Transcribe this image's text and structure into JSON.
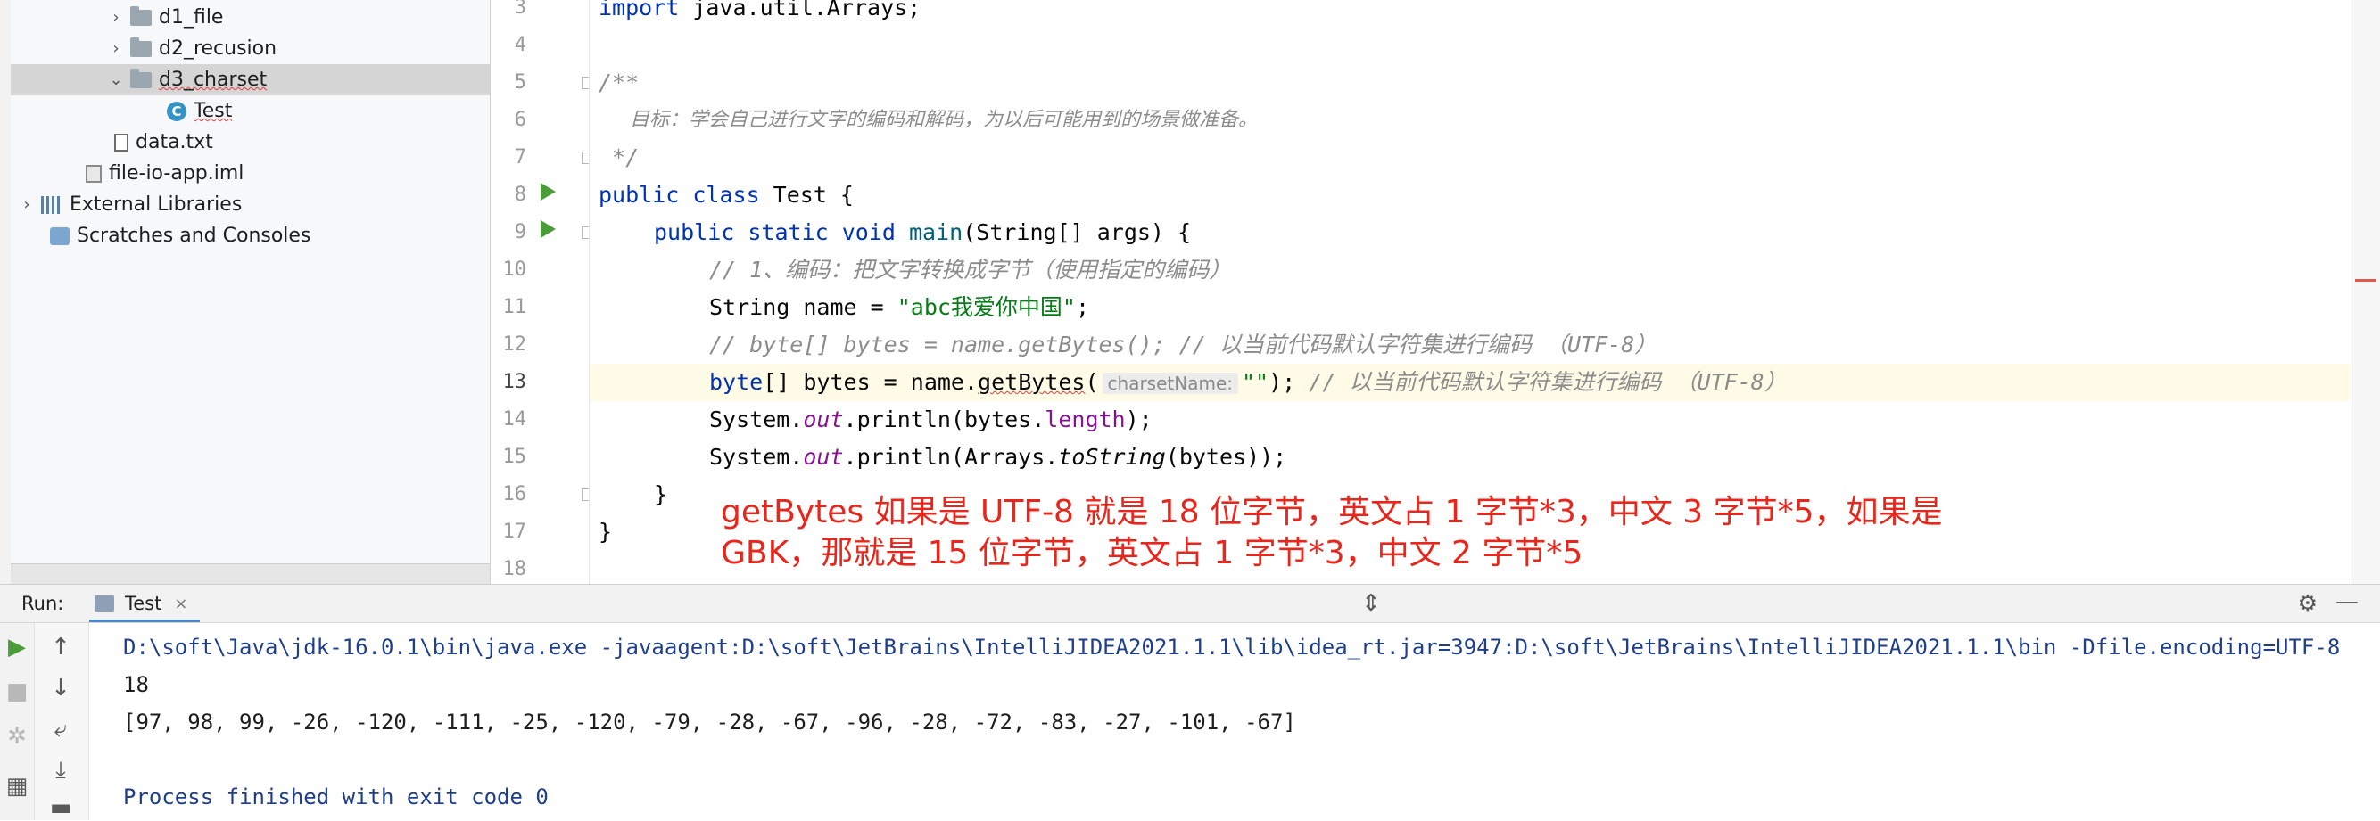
{
  "project_tree": {
    "items": [
      {
        "label": "d1_file",
        "type": "folder",
        "expanded": false
      },
      {
        "label": "d2_recusion",
        "type": "folder",
        "expanded": false
      },
      {
        "label": "d3_charset",
        "type": "folder",
        "expanded": true,
        "selected": true
      },
      {
        "label": "Test",
        "type": "class"
      },
      {
        "label": "data.txt",
        "type": "file"
      },
      {
        "label": "file-io-app.iml",
        "type": "module-file"
      },
      {
        "label": "External Libraries",
        "type": "libraries"
      },
      {
        "label": "Scratches and Consoles",
        "type": "scratches"
      }
    ]
  },
  "editor": {
    "line_numbers": [
      "3",
      "4",
      "5",
      "6",
      "7",
      "8",
      "9",
      "10",
      "11",
      "12",
      "13",
      "14",
      "15",
      "16",
      "17",
      "18"
    ],
    "current_line": "13",
    "lines": {
      "l3_kw": "import",
      "l3_rest": " java.util.Arrays;",
      "l5": "/**",
      "l6": "     目标：学会自己进行文字的编码和解码，为以后可能用到的场景做准备。",
      "l7": " */",
      "l8_kw": "public class",
      "l8_rest": " Test {",
      "l9_kw": "public static void",
      "l9_fn": "main",
      "l9_rest": "(String[] args) {",
      "l10": "// 1、编码：把文字转换成字节（使用指定的编码）",
      "l11_a": "String name = ",
      "l11_str": "\"abc我爱你中国\"",
      "l11_b": ";",
      "l12": "// byte[] bytes = name.getBytes(); // 以当前代码默认字符集进行编码 （UTF-8）",
      "l13_kw": "byte",
      "l13_a": "[] bytes = name.",
      "l13_method": "getBytes",
      "l13_b": "(",
      "l13_hint": "charsetName:",
      "l13_str": "\"\"",
      "l13_c": "); ",
      "l13_comment": "// 以当前代码默认字符集进行编码 （UTF-8）",
      "l14_a": "System.",
      "l14_out": "out",
      "l14_b": ".println(bytes.",
      "l14_len": "length",
      "l14_c": ");",
      "l15_a": "System.",
      "l15_out": "out",
      "l15_b": ".println(Arrays.",
      "l15_ts": "toString",
      "l15_c": "(bytes));",
      "l16": "}",
      "l17": "}"
    },
    "overlay_annotation": {
      "line1": "getBytes 如果是 UTF-8 就是 18 位字节，英文占 1 字节*3，中文 3 字节*5，如果是",
      "line2": "GBK，那就是 15 位字节，英文占 1 字节*3，中文 2 字节*5"
    }
  },
  "run_panel": {
    "label": "Run:",
    "tab_label": "Test",
    "console_lines": {
      "command": "D:\\soft\\Java\\jdk-16.0.1\\bin\\java.exe -javaagent:D:\\soft\\JetBrains\\IntelliJIDEA2021.1.1\\lib\\idea_rt.jar=3947:D:\\soft\\JetBrains\\IntelliJIDEA2021.1.1\\bin -Dfile.encoding=UTF-8",
      "length": "18",
      "array": "[97, 98, 99, -26, -120, -111, -25, -120, -79, -28, -67, -96, -28, -72, -83, -27, -101, -67]",
      "blank": "",
      "exit": "Process finished with exit code 0"
    }
  },
  "colors": {
    "keyword": "#0033b3",
    "string": "#067d17",
    "comment": "#8c8c8c",
    "annotation_red": "#e8261b",
    "run_green": "#4a9c3a"
  }
}
